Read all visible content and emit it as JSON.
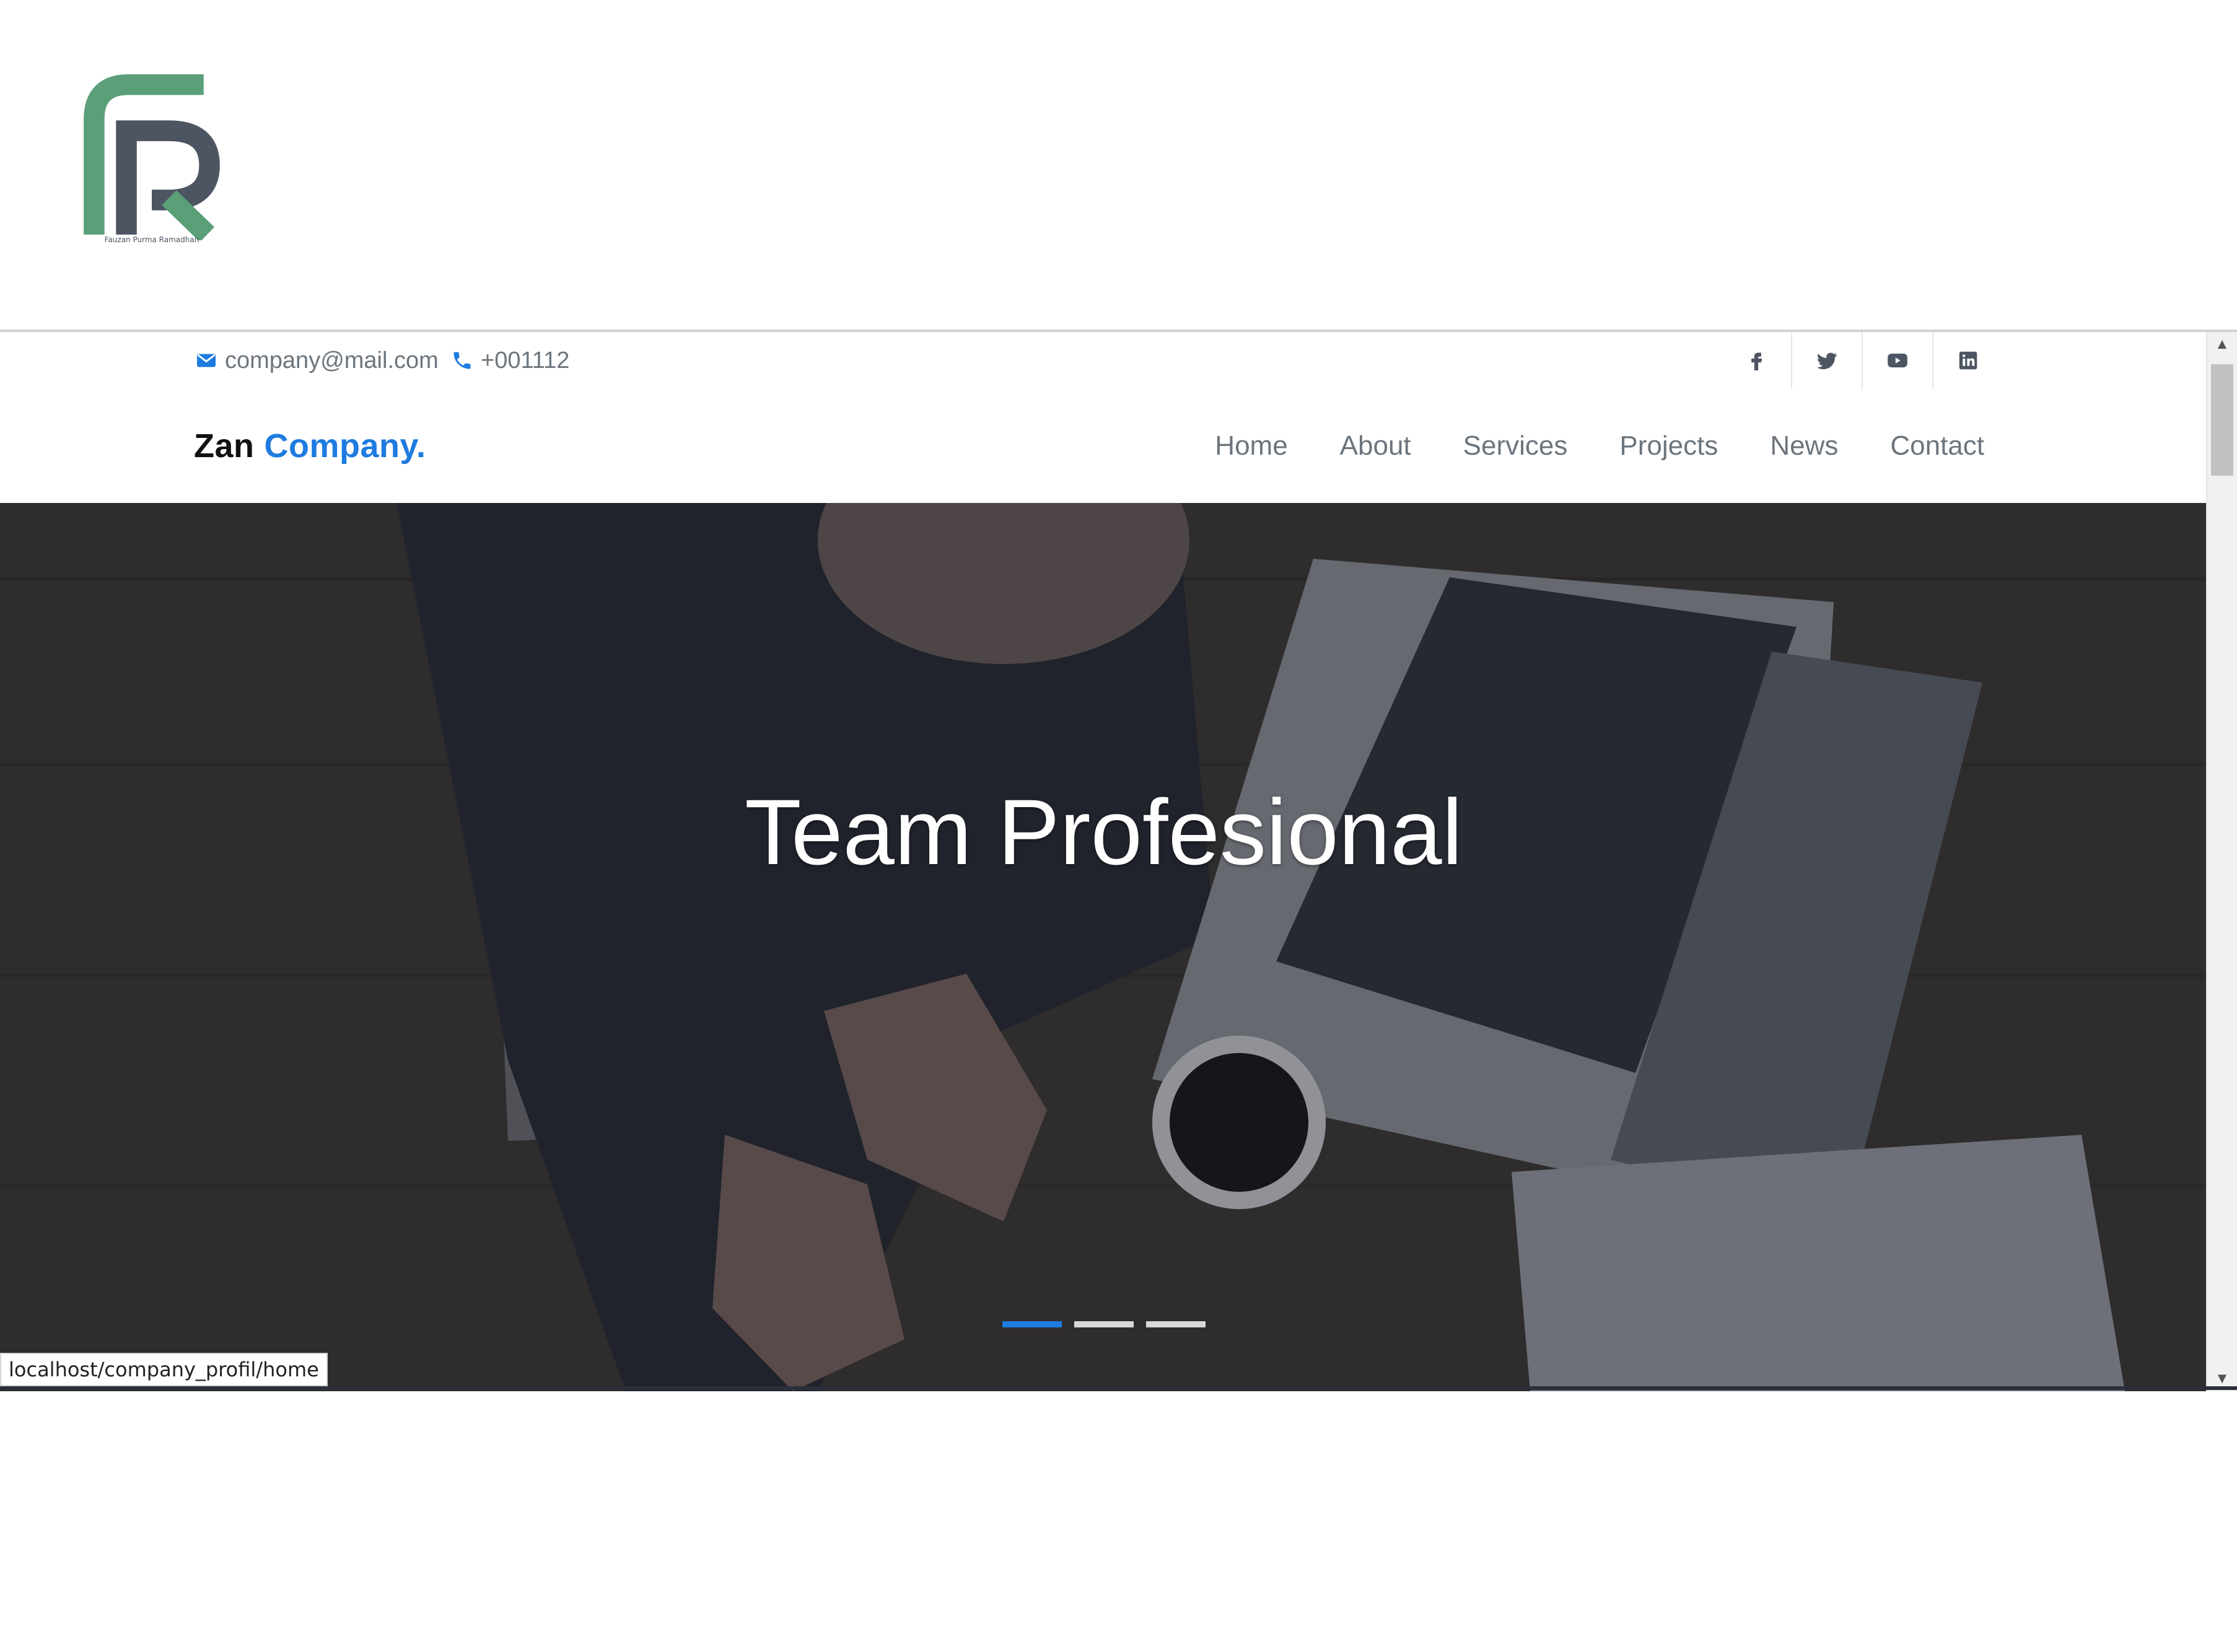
{
  "logo": {
    "caption": "Fauzan Purma Ramadhan"
  },
  "topbar": {
    "email": "company@mail.com",
    "phone": "+001112",
    "social": [
      "facebook-icon",
      "twitter-icon",
      "youtube-icon",
      "linkedin-icon"
    ]
  },
  "navbar": {
    "brand_part1": "Zan",
    "brand_part2": "Company.",
    "menu": [
      "Home",
      "About",
      "Services",
      "Projects",
      "News",
      "Contact"
    ]
  },
  "hero": {
    "title": "Team Profesional",
    "indicators": {
      "count": 3,
      "active_index": 0
    }
  },
  "status_bar": {
    "url": "localhost/company_profil/home"
  },
  "colors": {
    "accent": "#1e7be0",
    "logo_green": "#5a9f78",
    "logo_gray": "#4d5563"
  }
}
